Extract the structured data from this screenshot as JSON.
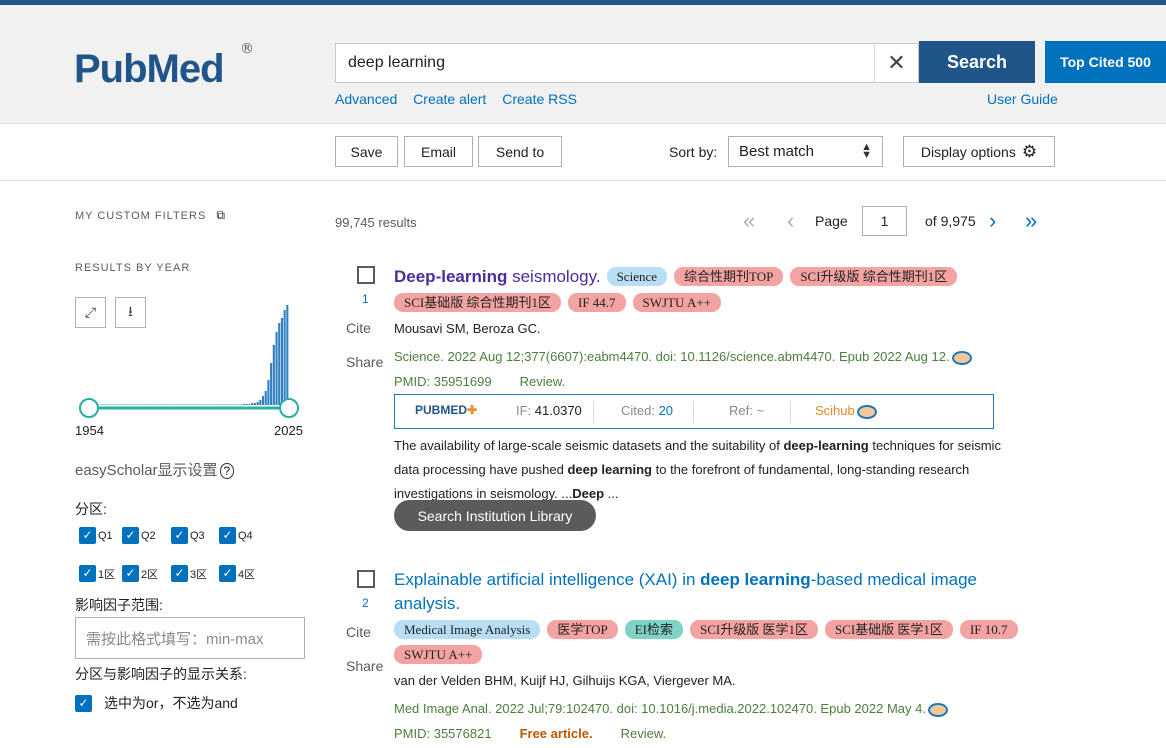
{
  "header": {
    "logo_main": "Pub",
    "logo_med": "Med",
    "logo_reg": "®",
    "search_value": "deep learning",
    "search_button": "Search",
    "top_cited": "Top Cited 500",
    "links": [
      "Advanced",
      "Create alert",
      "Create RSS"
    ],
    "user_guide": "User Guide"
  },
  "actions": {
    "save": "Save",
    "email": "Email",
    "send_to": "Send to",
    "sort_label": "Sort by:",
    "sort_value": "Best match",
    "display_options": "Display options"
  },
  "sidebar": {
    "custom_filters": "MY CUSTOM FILTERS",
    "results_by_year": "RESULTS BY YEAR",
    "year_start": "1954",
    "year_end": "2025",
    "easyscholar": "easyScholar显示设置",
    "fenqu_label": "分区:",
    "q_options": [
      "Q1",
      "Q2",
      "Q3",
      "Q4"
    ],
    "zone_options": [
      "1区",
      "2区",
      "3区",
      "4区"
    ],
    "if_range_label": "影响因子范围:",
    "if_placeholder": "需按此格式填写：min-max",
    "relation_label": "分区与影响因子的显示关系:",
    "relation_option": "选中为or，不选为and"
  },
  "results": {
    "count": "99,745 results",
    "page_label": "Page",
    "page_value": "1",
    "page_total": "of 9,975"
  },
  "articles": [
    {
      "num": "1",
      "cite": "Cite",
      "share": "Share",
      "title_bold": "Deep-learning",
      "title_rest": " seismology.",
      "tags": [
        {
          "text": "Science",
          "color": "blue"
        },
        {
          "text": "综合性期刊TOP",
          "color": "red"
        },
        {
          "text": "SCI升级版 综合性期刊1区",
          "color": "red"
        },
        {
          "text": "SCI基础版 综合性期刊1区",
          "color": "red"
        },
        {
          "text": "IF 44.7",
          "color": "red"
        },
        {
          "text": "SWJTU A++",
          "color": "red"
        }
      ],
      "authors": "Mousavi SM, Beroza GC.",
      "citation": "Science. 2022 Aug 12;377(6607):eabm4470. doi: 10.1126/science.abm4470. Epub 2022 Aug 12.",
      "pmid": "PMID: 35951699",
      "pubtype": "Review.",
      "stats": {
        "brand": "PUBMED",
        "if_label": "IF: ",
        "if_value": "41.0370",
        "cited_label": "Cited: ",
        "cited_value": "20",
        "ref_label": "Ref: ",
        "ref_value": "~",
        "scihub": "Scihub"
      },
      "abstract_parts": [
        "The availability of large-scale seismic datasets and the suitability of ",
        "deep-learning",
        " techniques for seismic data processing have pushed ",
        "deep learning",
        " to the forefront of fundamental, long-standing research investigations in seismology. ...",
        "Deep",
        " ..."
      ],
      "institution_button": "Search Institution Library"
    },
    {
      "num": "2",
      "cite": "Cite",
      "share": "Share",
      "title_pre": "Explainable artificial intelligence (XAI) in ",
      "title_bold": "deep learning",
      "title_rest": "-based medical image analysis.",
      "tags": [
        {
          "text": "Medical Image Analysis",
          "color": "blue"
        },
        {
          "text": "医学TOP",
          "color": "red"
        },
        {
          "text": "EI检索",
          "color": "teal"
        },
        {
          "text": "SCI升级版 医学1区",
          "color": "red"
        },
        {
          "text": "SCI基础版 医学1区",
          "color": "red"
        },
        {
          "text": "IF 10.7",
          "color": "red"
        },
        {
          "text": "SWJTU A++",
          "color": "red"
        }
      ],
      "authors": "van der Velden BHM, Kuijf HJ, Gilhuijs KGA, Viergever MA.",
      "citation": "Med Image Anal. 2022 Jul;79:102470. doi: 10.1016/j.media.2022.102470. Epub 2022 May 4.",
      "pmid": "PMID: 35576821",
      "free": "Free article.",
      "pubtype": "Review."
    }
  ],
  "colors": {
    "brand": "#20558a",
    "link": "#0071bc",
    "visited": "#4a2ea0",
    "source_green": "#4c7f3c",
    "tag_red": "#f4a3a3",
    "tag_blue": "#b8def5",
    "tag_teal": "#7fd3c6"
  },
  "chart_data": {
    "type": "bar",
    "x": [
      1954,
      2025
    ],
    "note_visible_only": "histogram rising sharply near 2025",
    "values": [
      0,
      0,
      0,
      0,
      0,
      0,
      0,
      0,
      0,
      0,
      0,
      0,
      0,
      0,
      0,
      0,
      0,
      0,
      0,
      0,
      0,
      0,
      0,
      0,
      0,
      0,
      0,
      0,
      0,
      0,
      0,
      0,
      0,
      0,
      0,
      0,
      0,
      0,
      0,
      0,
      0,
      0,
      0,
      0,
      0,
      0,
      0,
      0,
      0,
      0,
      0,
      0,
      0,
      0,
      0,
      0,
      0,
      0.01,
      0.01,
      0.01,
      0.02,
      0.02,
      0.03,
      0.05,
      0.09,
      0.14,
      0.25,
      0.42,
      0.6,
      0.73,
      0.82,
      0.87,
      0.95,
      1.0
    ]
  }
}
